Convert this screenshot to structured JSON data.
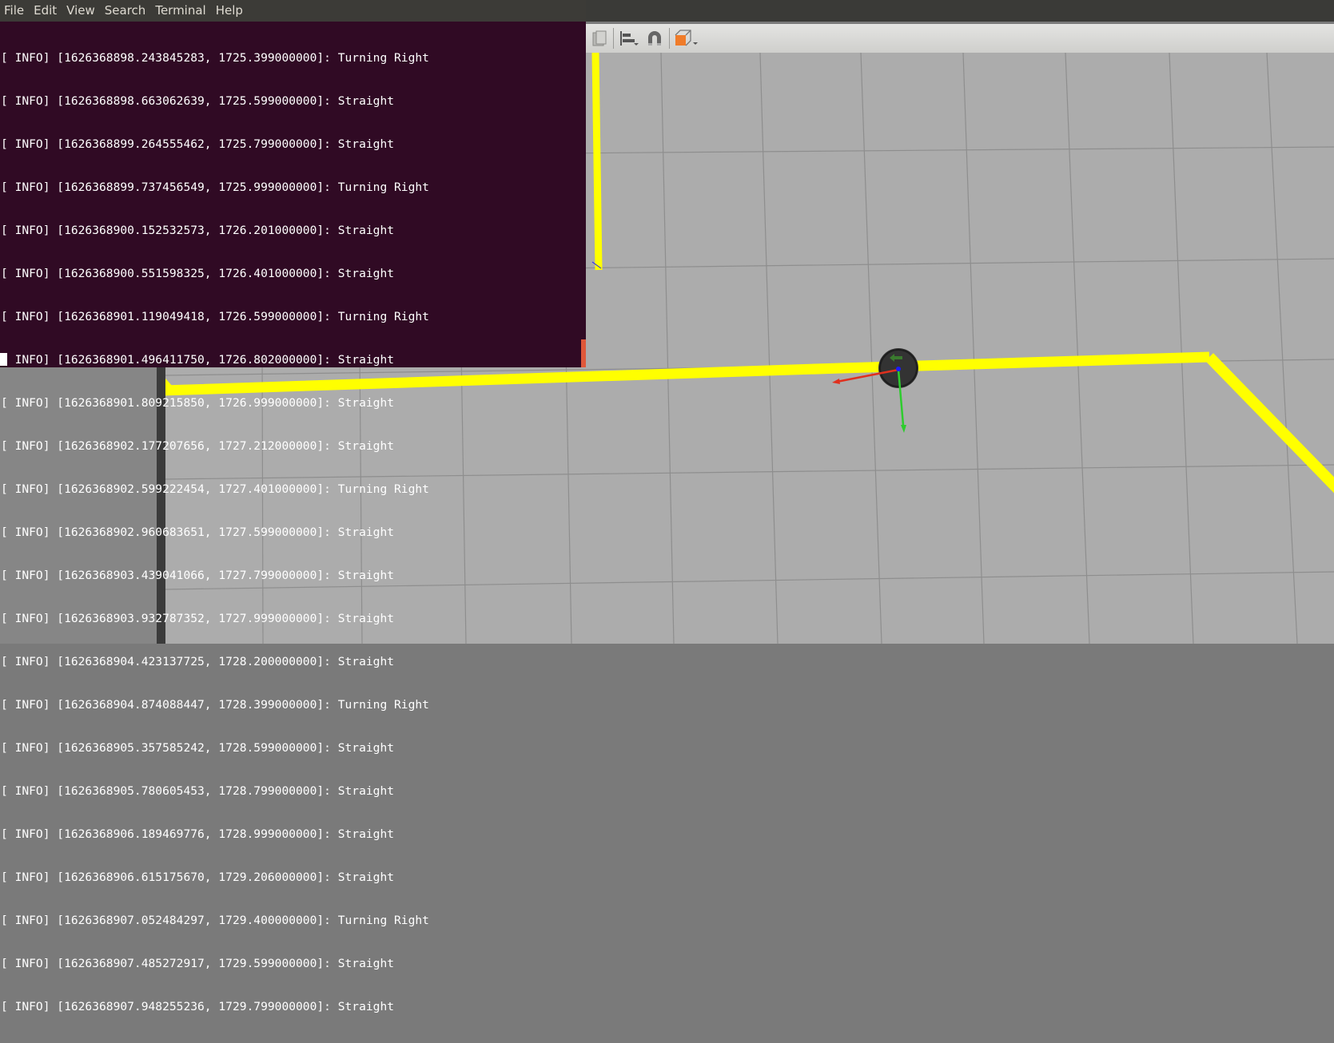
{
  "terminal": {
    "menu": [
      "File",
      "Edit",
      "View",
      "Search",
      "Terminal",
      "Help"
    ],
    "lines": [
      "[ INFO] [1626368898.243845283, 1725.399000000]: Turning Right",
      "[ INFO] [1626368898.663062639, 1725.599000000]: Straight",
      "[ INFO] [1626368899.264555462, 1725.799000000]: Straight",
      "[ INFO] [1626368899.737456549, 1725.999000000]: Turning Right",
      "[ INFO] [1626368900.152532573, 1726.201000000]: Straight",
      "[ INFO] [1626368900.551598325, 1726.401000000]: Straight",
      "[ INFO] [1626368901.119049418, 1726.599000000]: Turning Right",
      "[ INFO] [1626368901.496411750, 1726.802000000]: Straight",
      "[ INFO] [1626368901.809215850, 1726.999000000]: Straight",
      "[ INFO] [1626368902.177207656, 1727.212000000]: Straight",
      "[ INFO] [1626368902.599222454, 1727.401000000]: Turning Right",
      "[ INFO] [1626368902.960683651, 1727.599000000]: Straight",
      "[ INFO] [1626368903.439041066, 1727.799000000]: Straight",
      "[ INFO] [1626368903.932787352, 1727.999000000]: Straight",
      "[ INFO] [1626368904.423137725, 1728.200000000]: Straight",
      "[ INFO] [1626368904.874088447, 1728.399000000]: Turning Right",
      "[ INFO] [1626368905.357585242, 1728.599000000]: Straight",
      "[ INFO] [1626368905.780605453, 1728.799000000]: Straight",
      "[ INFO] [1626368906.189469776, 1728.999000000]: Straight",
      "[ INFO] [1626368906.615175670, 1729.206000000]: Straight",
      "[ INFO] [1626368907.052484297, 1729.400000000]: Turning Right",
      "[ INFO] [1626368907.485272917, 1729.599000000]: Straight",
      "[ INFO] [1626368907.948255236, 1729.799000000]: Straight"
    ]
  },
  "toolbar": {
    "icons": [
      "paste-icon",
      "align-icon",
      "magnet-snap-icon",
      "view-angle-cube-icon"
    ]
  },
  "colors": {
    "terminal_bg": "#300a24",
    "terminal_text": "#ffffff",
    "track": "#ffff00",
    "ground": "#acacac",
    "grid": "#8c8c8c",
    "axis_x": "#e0301e",
    "axis_y": "#2ecc2e",
    "axis_z": "#1a1aff",
    "robot": "#333333",
    "accent": "#f07c2a"
  }
}
